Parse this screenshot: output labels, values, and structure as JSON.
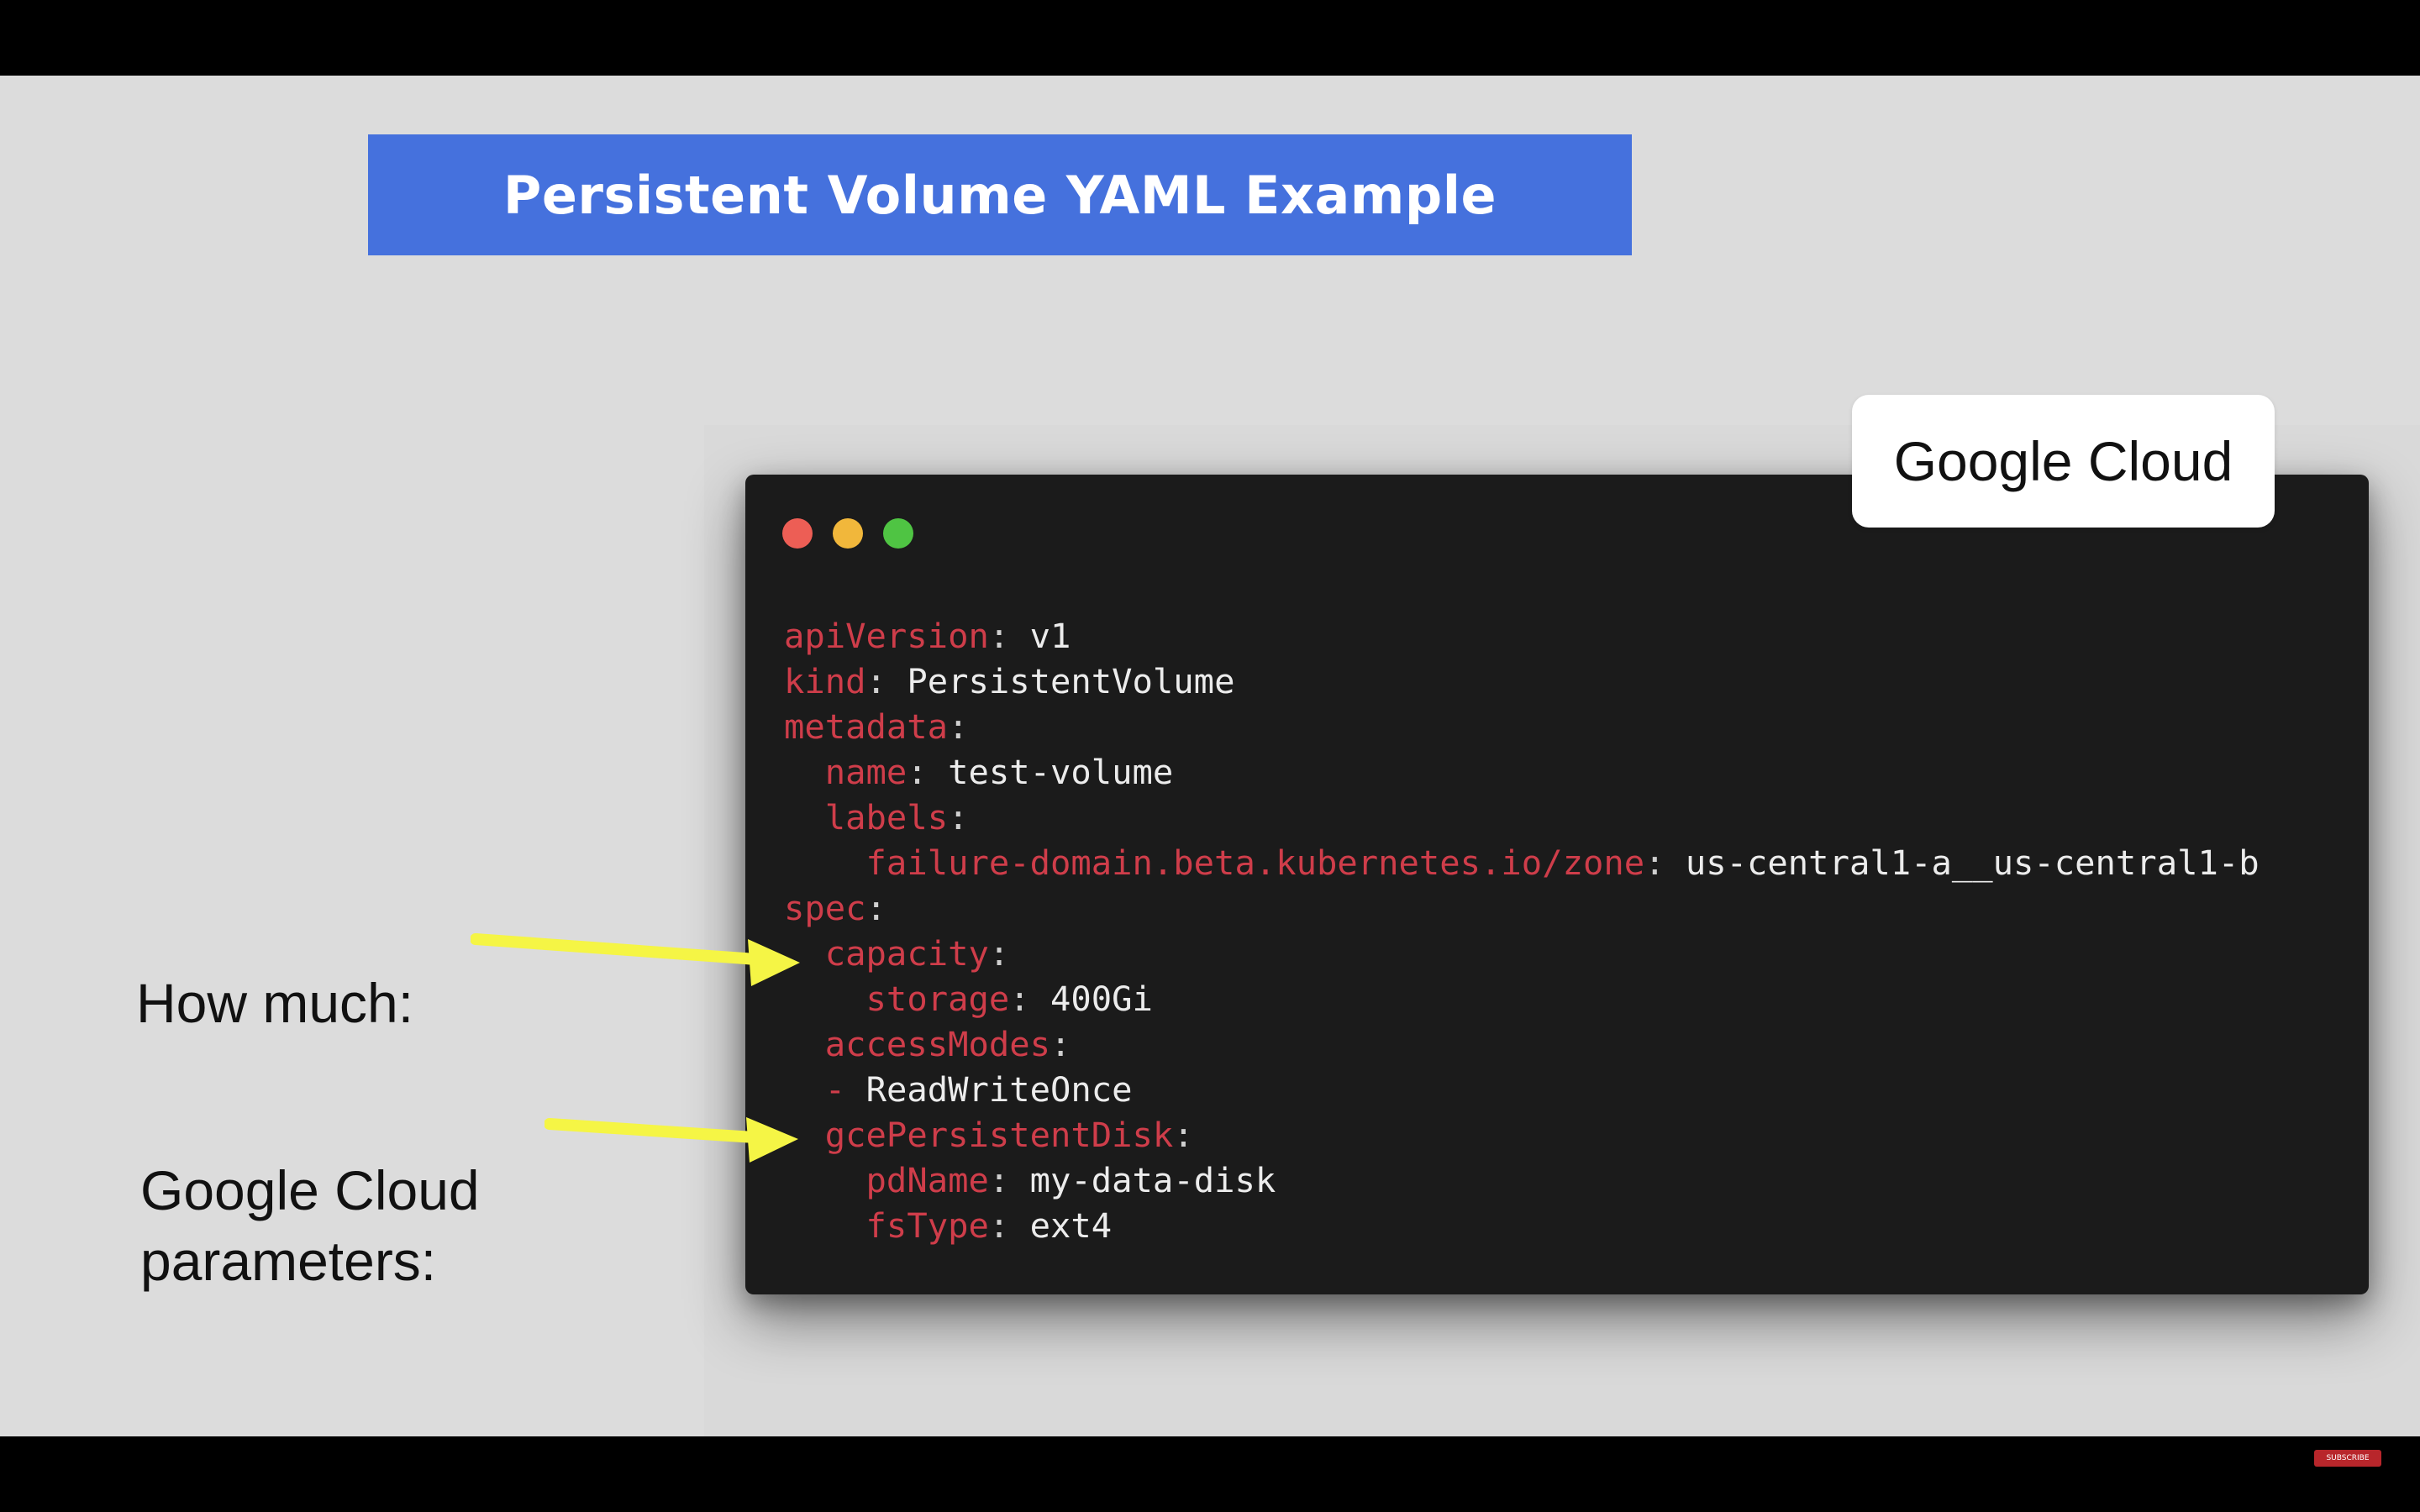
{
  "slide": {
    "title": "Persistent Volume YAML Example",
    "badge": "Google Cloud",
    "annotations": {
      "how_much": "How much:",
      "google_cloud_line1": "Google Cloud",
      "google_cloud_line2": "parameters:"
    }
  },
  "terminal": {
    "window_buttons": [
      "close",
      "minimize",
      "maximize"
    ],
    "lines": [
      {
        "indent": "",
        "key": "apiVersion",
        "value": " v1"
      },
      {
        "indent": "",
        "key": "kind",
        "value": " PersistentVolume"
      },
      {
        "indent": "",
        "key": "metadata",
        "value": ""
      },
      {
        "indent": "  ",
        "key": "name",
        "value": " test-volume"
      },
      {
        "indent": "  ",
        "key": "labels",
        "value": ""
      },
      {
        "indent": "    ",
        "key": "failure-domain.beta.kubernetes.io/zone",
        "value": " us-central1-a__us-central1-b"
      },
      {
        "indent": "",
        "key": "spec",
        "value": ""
      },
      {
        "indent": "  ",
        "key": "capacity",
        "value": ""
      },
      {
        "indent": "    ",
        "key": "storage",
        "value": " 400Gi"
      },
      {
        "indent": "  ",
        "key": "accessModes",
        "value": ""
      },
      {
        "indent": "  ",
        "key": "",
        "dash": "- ",
        "value": "ReadWriteOnce"
      },
      {
        "indent": "  ",
        "key": "gcePersistentDisk",
        "value": ""
      },
      {
        "indent": "    ",
        "key": "pdName",
        "value": " my-data-disk"
      },
      {
        "indent": "    ",
        "key": "fsType",
        "value": " ext4"
      }
    ]
  },
  "colors": {
    "title_bar": "#4571dd",
    "terminal_bg": "#1b1b1b",
    "yaml_key": "#cf3d4a",
    "arrow": "#f5f545"
  },
  "footer": {
    "youtube_badge": "SUBSCRIBE"
  }
}
